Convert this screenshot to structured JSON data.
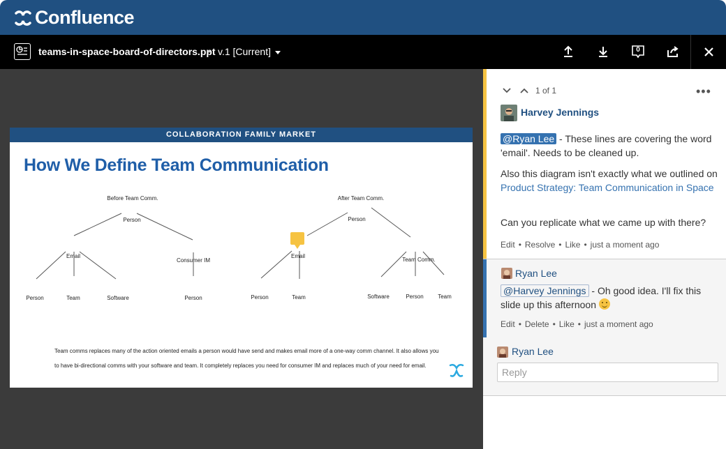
{
  "app": {
    "name": "Confluence",
    "brand_color": "#205081"
  },
  "file": {
    "name": "teams-in-space-board-of-directors.ppt",
    "separator": "•",
    "version": "v.1 [Current]",
    "comment_count": "0",
    "tools": [
      "upload-icon",
      "download-icon",
      "comment-icon",
      "share-icon",
      "close-icon"
    ]
  },
  "slide": {
    "band": "COLLABORATION FAMILY MARKET",
    "title": "How We Define Team Communication",
    "before": {
      "heading": "Before Team Comm.",
      "root": "Person",
      "email": "Email",
      "consumer_im": "Consumer IM",
      "leaf_person": "Person",
      "leaf_team": "Team",
      "leaf_software": "Software",
      "leaf_person2": "Person"
    },
    "after": {
      "heading": "After Team Comm.",
      "root": "Person",
      "email": "Email",
      "team_comm": "Team Comm.",
      "leaf_person": "Person",
      "leaf_team": "Team",
      "leaf_software": "Software",
      "leaf_person2": "Person",
      "leaf_team2": "Team"
    },
    "desc_line1": "Team comms replaces many of the action oriented emails a person would have send and makes email more of a one-way comm channel. It also allows you",
    "desc_line2": "to have bi-directional comms with your software and team.  It completely replaces you need for consumer IM and replaces much of your need for email."
  },
  "comments": {
    "count": "1 of 1",
    "more": "•••",
    "main": {
      "author": "Harvey Jennings",
      "mention": "@Ryan Lee",
      "text1": " - These lines are covering the word 'email'. Needs to be cleaned up.",
      "text2_prefix": "Also this diagram isn't exactly what we outlined on ",
      "text2_link": "Product Strategy: Team Communication in Space",
      "text3": "Can you replicate what we came up with there?",
      "actions": [
        "Edit",
        "Resolve",
        "Like"
      ],
      "time": "just a moment ago"
    },
    "reply": {
      "author": "Ryan Lee",
      "mention": "@Harvey Jennings",
      "text": " - Oh good idea. I'll fix this slide up this afternoon ",
      "actions": [
        "Edit",
        "Delete",
        "Like"
      ],
      "time": "just a moment ago"
    },
    "composer": {
      "author": "Ryan Lee",
      "placeholder": "Reply"
    },
    "highlight_color": "#f6c342",
    "reply_color": "#3572b0"
  }
}
